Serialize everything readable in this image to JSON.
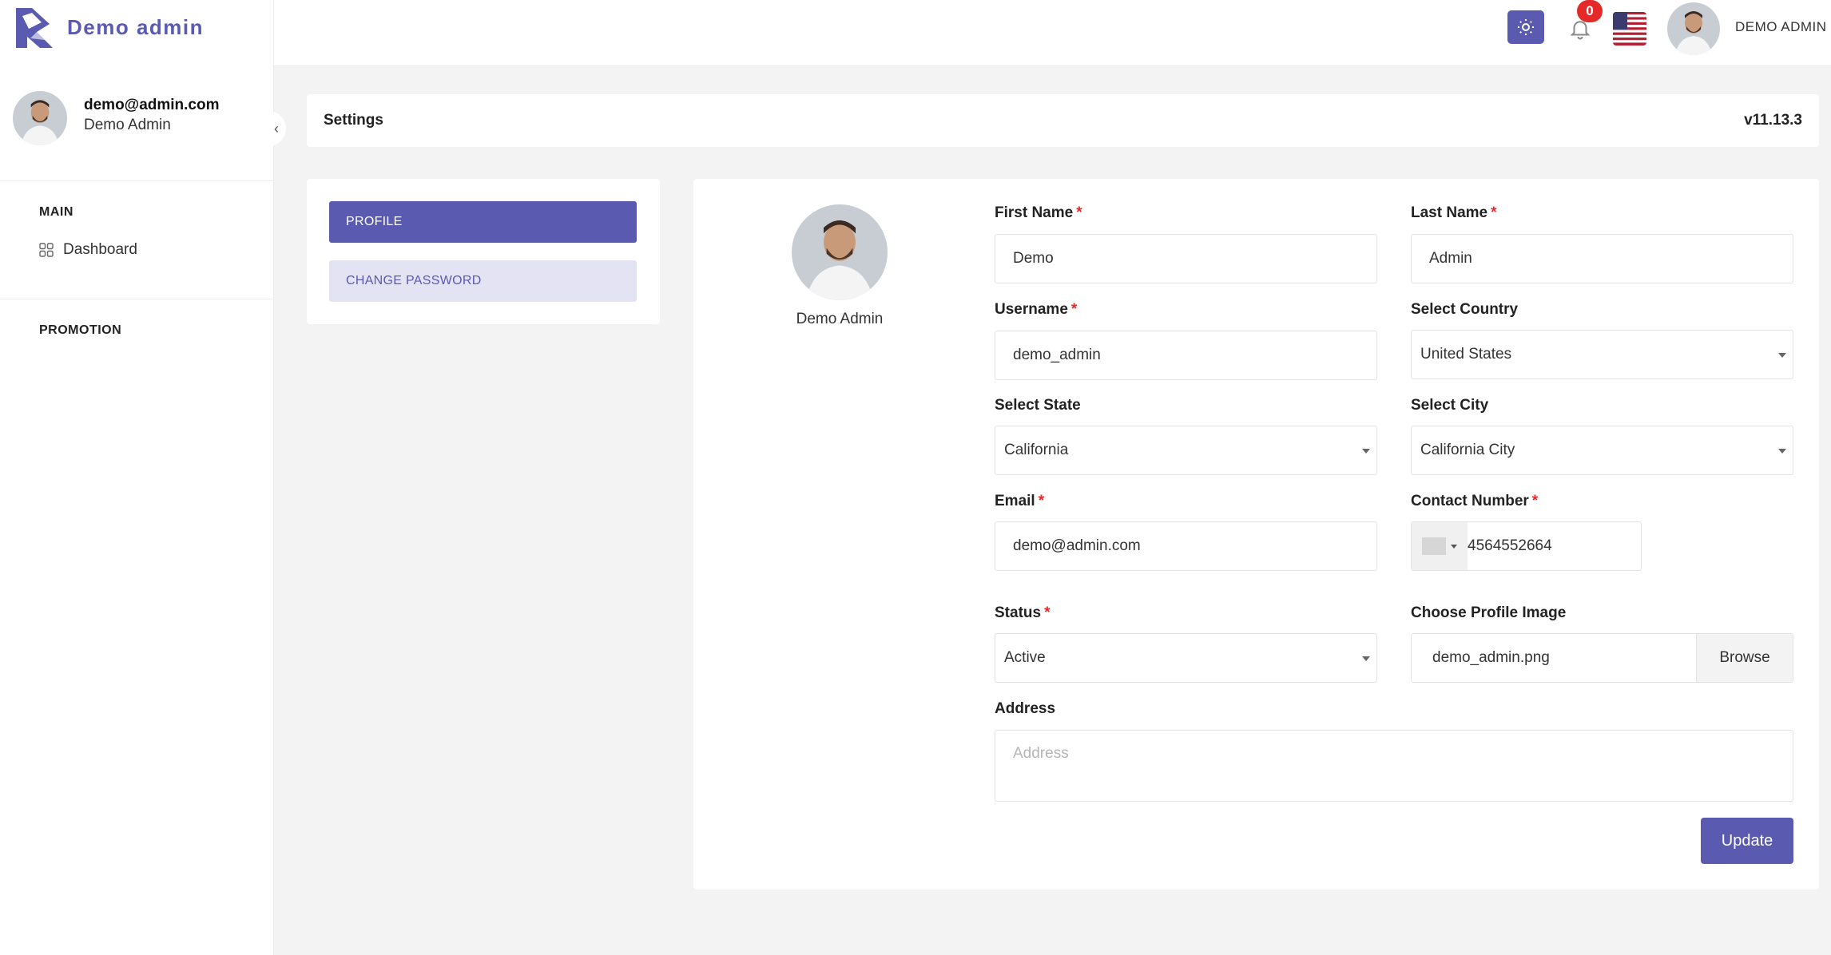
{
  "app": {
    "title": "Demo admin"
  },
  "header": {
    "notification_count": "0",
    "user_name": "DEMO ADMIN"
  },
  "sidebar": {
    "email": "demo@admin.com",
    "name": "Demo Admin",
    "sections": [
      {
        "title": "MAIN",
        "items": [
          {
            "label": "Dashboard"
          }
        ]
      },
      {
        "title": "PROMOTION",
        "items": []
      }
    ]
  },
  "settings": {
    "title": "Settings",
    "version": "v11.13.3"
  },
  "tabs": [
    {
      "label": "PROFILE",
      "active": true
    },
    {
      "label": "CHANGE PASSWORD",
      "active": false
    }
  ],
  "profile": {
    "display_name": "Demo Admin",
    "fields": {
      "first_name": {
        "label": "First Name",
        "value": "Demo"
      },
      "last_name": {
        "label": "Last Name",
        "value": "Admin"
      },
      "username": {
        "label": "Username",
        "value": "demo_admin"
      },
      "country": {
        "label": "Select Country",
        "value": "United States"
      },
      "state": {
        "label": "Select State",
        "value": "California"
      },
      "city": {
        "label": "Select City",
        "value": "California City"
      },
      "email": {
        "label": "Email",
        "value": "demo@admin.com"
      },
      "contact": {
        "label": "Contact Number",
        "value": "4564552664"
      },
      "status": {
        "label": "Status",
        "value": "Active"
      },
      "profile_image": {
        "label": "Choose Profile Image",
        "value": "demo_admin.png",
        "browse_label": "Browse"
      },
      "address": {
        "label": "Address",
        "placeholder": "Address"
      }
    },
    "required_marker": "*",
    "update_label": "Update"
  },
  "colors": {
    "primary": "#5b5ab1",
    "primary_light": "#e4e3f3",
    "danger": "#e52929",
    "background": "#f3f3f4"
  }
}
